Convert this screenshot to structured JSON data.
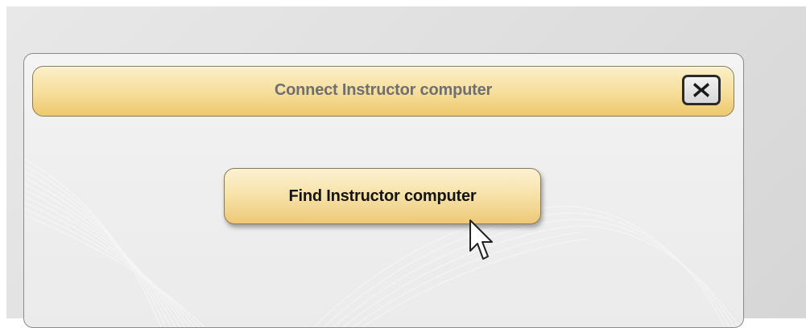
{
  "dialog": {
    "title": "Connect Instructor computer",
    "close_icon": "close-x-icon",
    "primary_button_label": "Find Instructor computer"
  },
  "colors": {
    "title_bar_gold": "#f6dd99",
    "button_gold": "#f6dfa2",
    "title_text": "#6f6f6f",
    "button_text": "#141414"
  },
  "cursor_icon": "mouse-pointer-icon"
}
